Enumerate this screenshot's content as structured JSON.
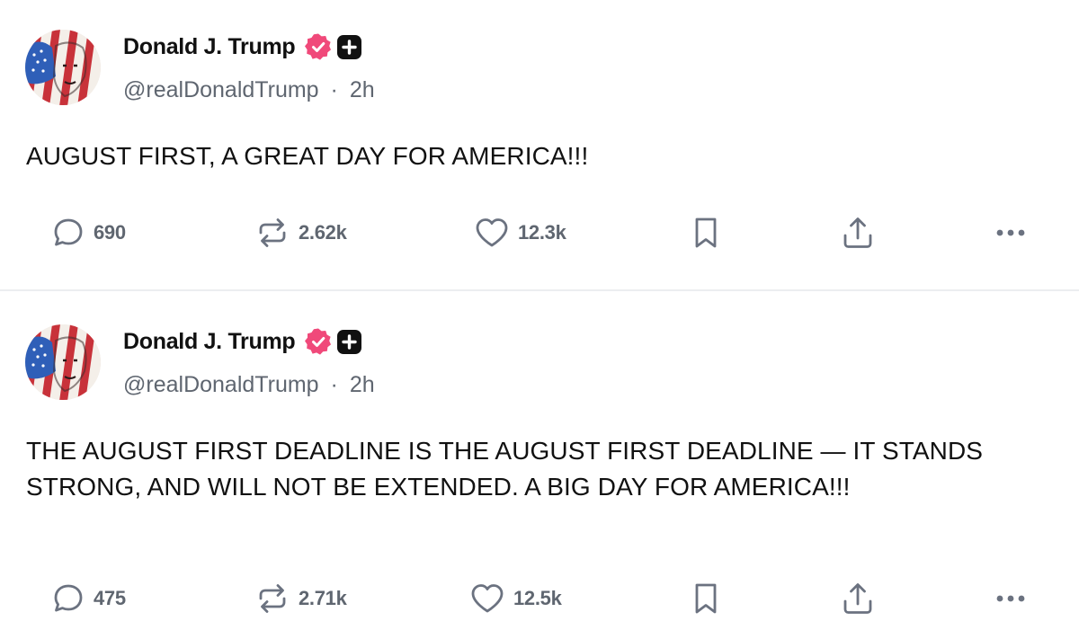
{
  "colors": {
    "verified_badge": "#f0497a",
    "plus_badge": "#111111",
    "muted_text": "#5f6670",
    "icon_stroke": "#6b7280",
    "divider": "#eceef0"
  },
  "icons": {
    "reply": "comment-bubble-icon",
    "repost": "repost-arrows-icon",
    "like": "heart-icon",
    "bookmark": "bookmark-icon",
    "share": "share-upload-icon",
    "more": "more-dots-icon",
    "verified": "verified-check-badge-icon",
    "plus": "plus-badge-icon"
  },
  "posts": [
    {
      "author": {
        "display_name": "Donald J. Trump",
        "handle": "@realDonaldTrump",
        "separator": "·",
        "time": "2h"
      },
      "text": "AUGUST FIRST, A GREAT DAY FOR AMERICA!!!",
      "stats": {
        "replies": "690",
        "reposts": "2.62k",
        "likes": "12.3k"
      }
    },
    {
      "author": {
        "display_name": "Donald J. Trump",
        "handle": "@realDonaldTrump",
        "separator": "·",
        "time": "2h"
      },
      "text": "THE AUGUST FIRST DEADLINE IS THE AUGUST FIRST DEADLINE — IT STANDS STRONG, AND WILL NOT BE EXTENDED. A BIG DAY FOR AMERICA!!!",
      "stats": {
        "replies": "475",
        "reposts": "2.71k",
        "likes": "12.5k"
      }
    }
  ]
}
